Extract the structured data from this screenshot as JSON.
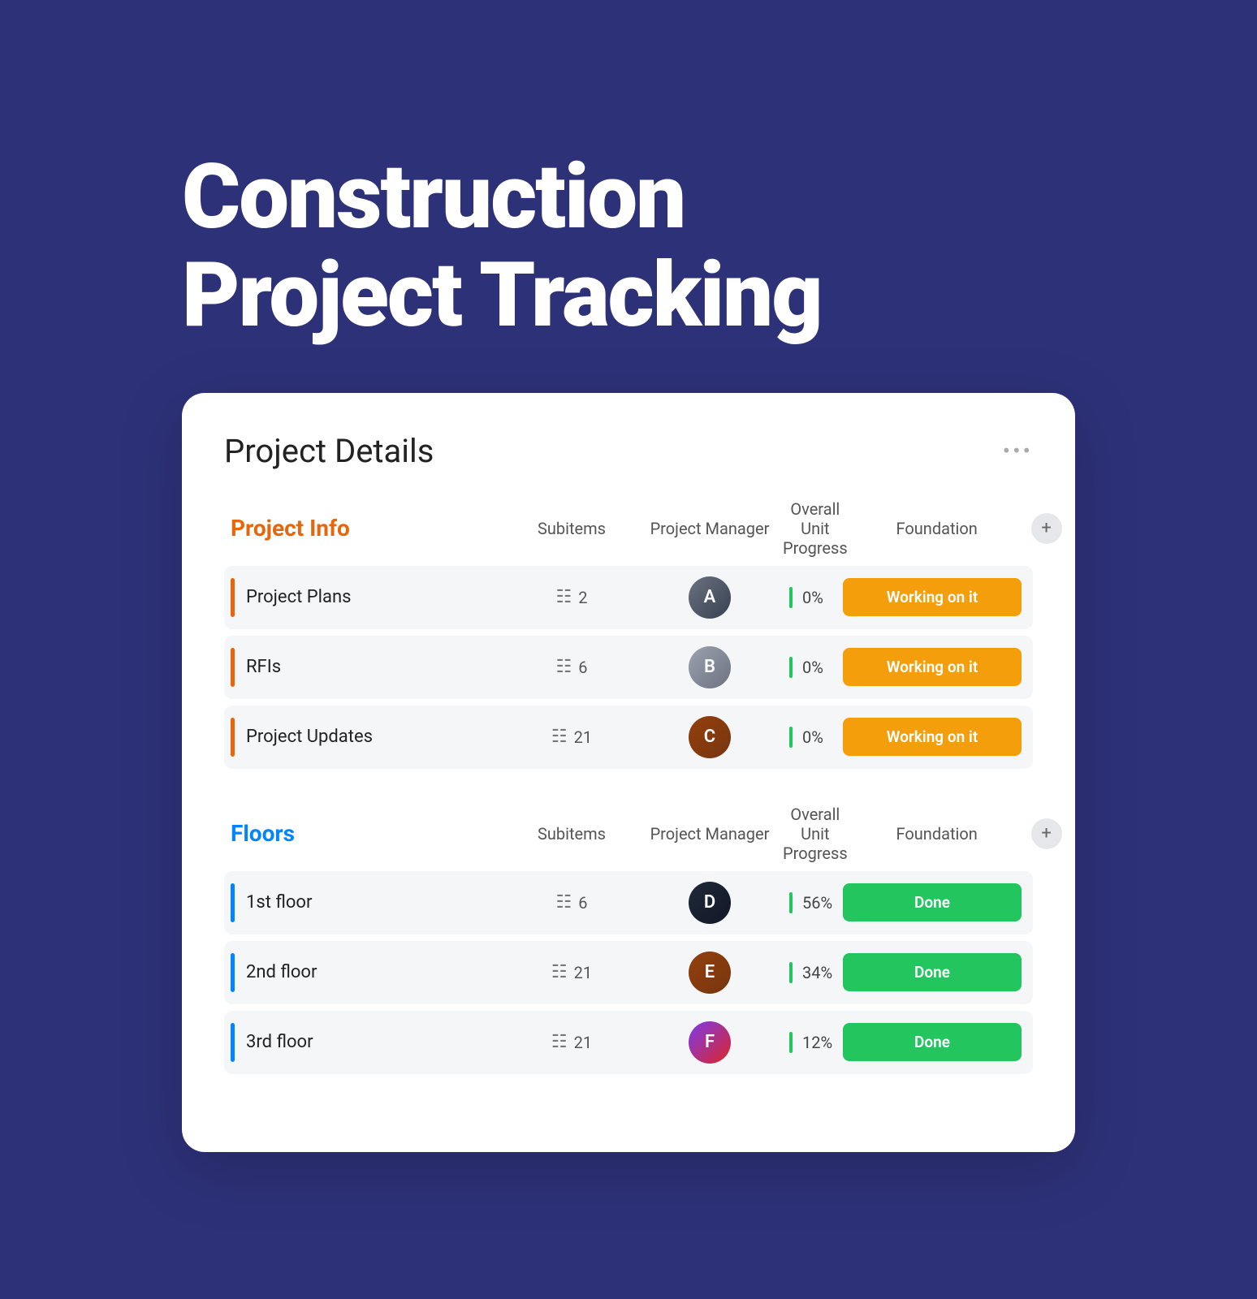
{
  "hero": {
    "title_line1": "Construction",
    "title_line2": "Project Tracking"
  },
  "card": {
    "title": "Project Details",
    "more_icon": "•••",
    "sections": [
      {
        "id": "project-info",
        "title": "Project Info",
        "color": "orange",
        "col_headers": [
          "",
          "Subitems",
          "Project Manager",
          "Overall Unit Progress",
          "Foundation",
          ""
        ],
        "rows": [
          {
            "name": "Project Plans",
            "subitems": 2,
            "avatar_class": "av1",
            "avatar_initial": "A",
            "progress": 0,
            "status": "Working on it",
            "badge_class": "badge-orange"
          },
          {
            "name": "RFIs",
            "subitems": 6,
            "avatar_class": "av2",
            "avatar_initial": "B",
            "progress": 0,
            "status": "Working on it",
            "badge_class": "badge-orange"
          },
          {
            "name": "Project Updates",
            "subitems": 21,
            "avatar_class": "av3",
            "avatar_initial": "C",
            "progress": 0,
            "status": "Working on it",
            "badge_class": "badge-orange"
          }
        ]
      },
      {
        "id": "floors",
        "title": "Floors",
        "color": "blue",
        "col_headers": [
          "",
          "Subitems",
          "Project Manager",
          "Overall Unit Progress",
          "Foundation",
          ""
        ],
        "rows": [
          {
            "name": "1st floor",
            "subitems": 6,
            "avatar_class": "av4",
            "avatar_initial": "D",
            "progress": 56,
            "status": "Done",
            "badge_class": "badge-green"
          },
          {
            "name": "2nd floor",
            "subitems": 21,
            "avatar_class": "av5",
            "avatar_initial": "E",
            "progress": 34,
            "status": "Done",
            "badge_class": "badge-green"
          },
          {
            "name": "3rd floor",
            "subitems": 21,
            "avatar_class": "av6",
            "avatar_initial": "F",
            "progress": 12,
            "status": "Done",
            "badge_class": "badge-green"
          }
        ]
      }
    ]
  }
}
